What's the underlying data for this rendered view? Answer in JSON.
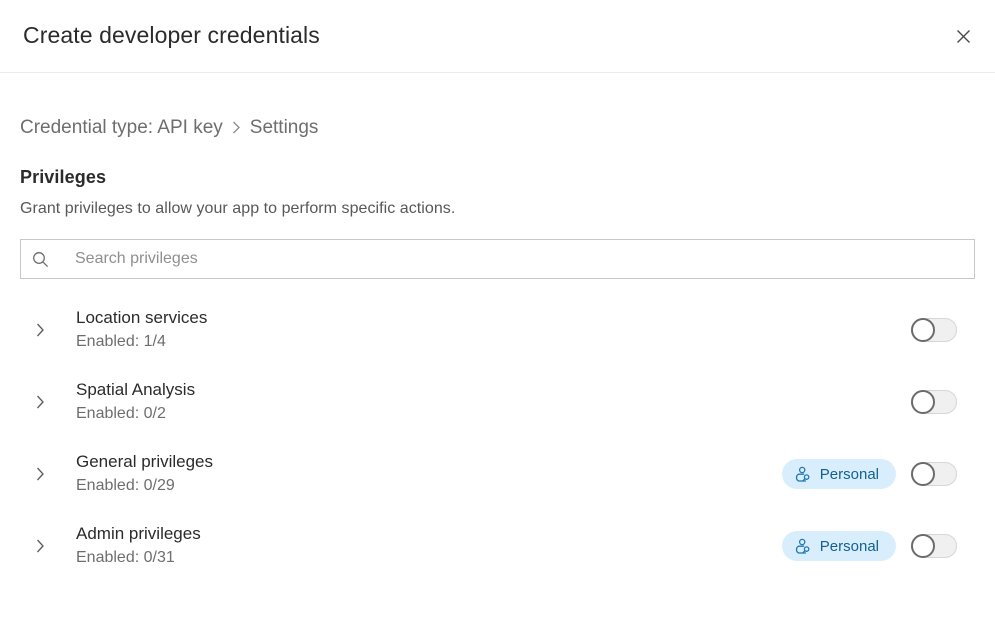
{
  "header": {
    "title": "Create developer credentials",
    "close_label": "Close"
  },
  "breadcrumb": {
    "items": [
      "Credential type: API key",
      "Settings"
    ],
    "separator": "›"
  },
  "section": {
    "title": "Privileges",
    "description": "Grant privileges to allow your app to perform specific actions."
  },
  "search": {
    "placeholder": "Search privileges",
    "value": ""
  },
  "colors": {
    "badge_background": "#d9eefc",
    "badge_text": "#14618f",
    "toggle_off_track": "#f0f0f0",
    "toggle_knob_border": "#6b6b6b",
    "border": "#c8c8c8"
  },
  "privileges": [
    {
      "label": "Location services",
      "enabled_text": "Enabled: 1/4",
      "badge": null,
      "toggle_on": false
    },
    {
      "label": "Spatial Analysis",
      "enabled_text": "Enabled: 0/2",
      "badge": null,
      "toggle_on": false
    },
    {
      "label": "General privileges",
      "enabled_text": "Enabled: 0/29",
      "badge": "Personal",
      "toggle_on": false
    },
    {
      "label": "Admin privileges",
      "enabled_text": "Enabled: 0/31",
      "badge": "Personal",
      "toggle_on": false
    }
  ]
}
